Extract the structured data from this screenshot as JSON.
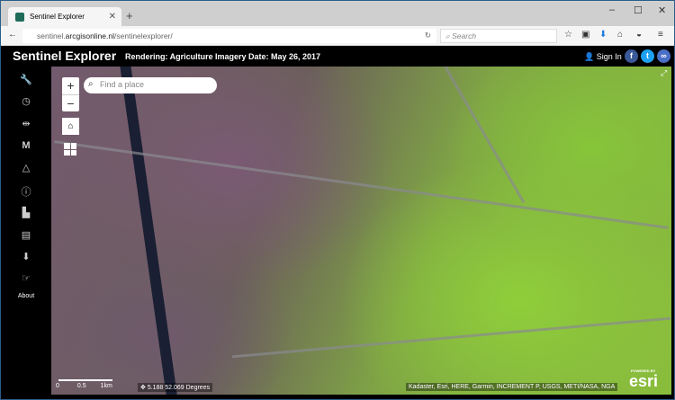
{
  "browser": {
    "tab_title": "Sentinel Explorer",
    "url_host": "sentinel.",
    "url_domain": "arcgisonline.nl",
    "url_path": "/sentinelexplorer/",
    "search_placeholder": "Search"
  },
  "header": {
    "title": "Sentinel Explorer",
    "rendering": "Rendering: Agriculture",
    "imagery_date": "Imagery Date: May 26, 2017",
    "sign_in": "Sign In"
  },
  "sidebar": {
    "about": "About",
    "icons": [
      "wrench-icon",
      "clock-icon",
      "compare-icon",
      "m-icon",
      "triangle-icon",
      "info-icon",
      "bookmark-add-icon",
      "save-icon",
      "download-icon",
      "hand-icon"
    ]
  },
  "map": {
    "search_placeholder": "Find a place",
    "scale_0": "0",
    "scale_mid": "0.5",
    "scale_end": "1km",
    "coords": "5.188 52.069 Degrees",
    "attribution": "Kadaster, Esri, HERE, Garmin, INCREMENT P, USGS, METI/NASA, NGA",
    "powered_by": "POWERED BY",
    "esri": "esri"
  },
  "colors": {
    "facebook": "#3b5998",
    "twitter": "#1da1f2",
    "link": "#4a6fc7"
  }
}
